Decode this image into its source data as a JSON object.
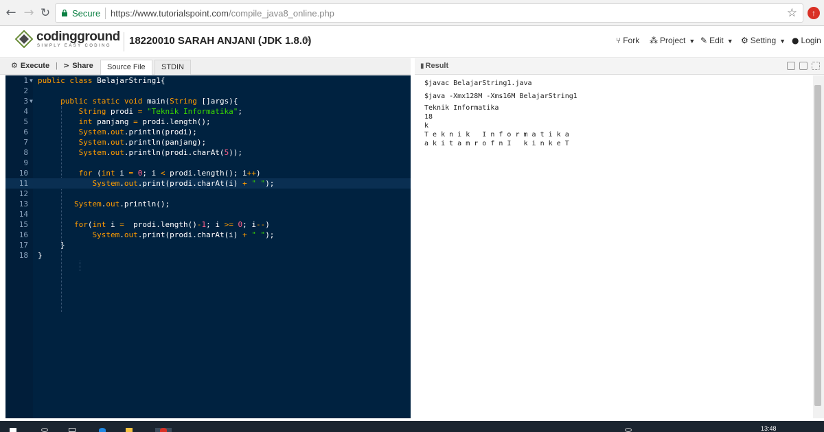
{
  "browser": {
    "secure_label": "Secure",
    "url_host": "https://www.tutorialspoint.com",
    "url_path": "/compile_java8_online.php"
  },
  "header": {
    "logo_text": "codingground",
    "logo_tagline": "SIMPLY EASY CODING",
    "project_title": "18220010 SARAH ANJANI (JDK 1.8.0)",
    "menu": {
      "fork": "Fork",
      "project": "Project",
      "edit": "Edit",
      "setting": "Setting",
      "login": "Login"
    }
  },
  "toolbar": {
    "execute_label": "Execute",
    "share_label": "Share",
    "tabs": [
      "Source File",
      "STDIN"
    ],
    "result_label": "Result"
  },
  "editor": {
    "line_numbers": [
      "1",
      "2",
      "3",
      "4",
      "5",
      "6",
      "7",
      "8",
      "9",
      "10",
      "11",
      "12",
      "13",
      "14",
      "15",
      "16",
      "17",
      "18"
    ],
    "active_line": 11,
    "lines": [
      "public class BelajarString1{",
      "",
      "    public static void main(String []args){",
      "        String prodi = \"Teknik Informatika\";",
      "        int panjang = prodi.length();",
      "        System.out.println(prodi);",
      "        System.out.println(panjang);",
      "        System.out.println(prodi.charAt(5));",
      "",
      "        for (int i = 0; i < prodi.length(); i++)",
      "           System.out.print(prodi.charAt(i) + \" \");",
      "",
      "       System.out.println();",
      "",
      "       for(int i =  prodi.length()-1; i >= 0; i--)",
      "           System.out.print(prodi.charAt(i) + \" \");",
      "    }",
      "}"
    ]
  },
  "result": {
    "lines": [
      "$javac BelajarString1.java",
      "$java -Xmx128M -Xms16M BelajarString1",
      "Teknik Informatika",
      "18",
      "k",
      "T e k n i k   I n f o r m a t i k a",
      "a k i t a m r o f n I   k i n k e T"
    ]
  },
  "taskbar": {
    "clock": "13:48"
  },
  "colors": {
    "editor_bg": "#002240",
    "keyword": "#ff9d00",
    "string": "#3ad900",
    "number": "#ff628c",
    "secure_green": "#0b8043"
  }
}
